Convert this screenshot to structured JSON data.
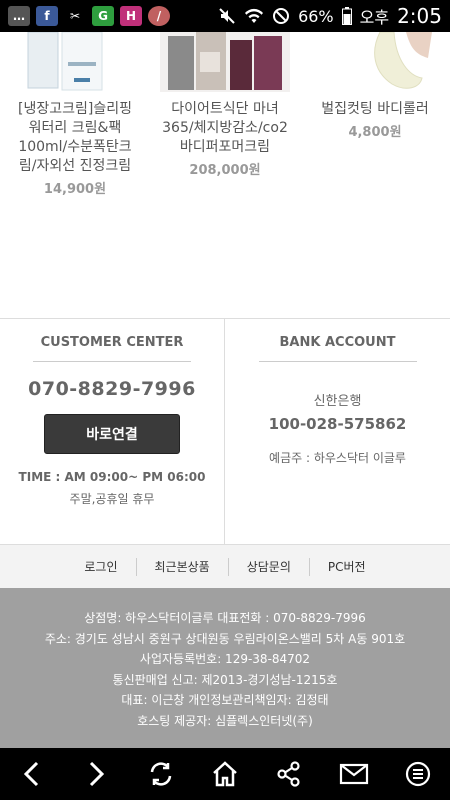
{
  "status_bar": {
    "battery": "66%",
    "ampm": "오후",
    "time": "2:05",
    "app_icons": [
      {
        "name": "message-icon",
        "label": "…",
        "color": "#555555"
      },
      {
        "name": "facebook-icon",
        "label": "f",
        "color": "#3b5998"
      },
      {
        "name": "scissors-icon",
        "label": "✂",
        "color": "#000000"
      },
      {
        "name": "g-app-icon",
        "label": "G",
        "color": "#2e9e3e"
      },
      {
        "name": "h-app-icon",
        "label": "H",
        "color": "#c0307a"
      },
      {
        "name": "circle-app-icon",
        "label": "/",
        "color": "#c06060"
      }
    ]
  },
  "products": [
    {
      "name": "[냉장고크림]슬리핑 워터리 크림&팩 100ml/수분폭탄크림/자외선 진정크림",
      "price": "14,900원"
    },
    {
      "name": "다이어트식단 마녀365/체지방감소/co2바디퍼포머크림",
      "price": "208,000원"
    },
    {
      "name": "벌집컷팅 바디롤러",
      "price": "4,800원"
    }
  ],
  "customer_center": {
    "heading": "CUSTOMER CENTER",
    "phone": "070-8829-7996",
    "call_label": "바로연결",
    "time": "TIME : AM 09:00~ PM 06:00",
    "holiday": "주말,공휴일 휴무"
  },
  "bank_account": {
    "heading": "BANK ACCOUNT",
    "bank": "신한은행",
    "account": "100-028-575862",
    "holder": "예금주 : 하우스닥터 이글루"
  },
  "footer_nav": [
    "로그인",
    "최근본상품",
    "상담문의",
    "PC버전"
  ],
  "company_info": [
    "상점명: 하우스닥터이글루 대표전화 : 070-8829-7996",
    "주소: 경기도 성남시 중원구 상대원동 우림라이온스밸리 5차 A동 901호",
    "사업자등록번호: 129-38-84702",
    "통신판매업 신고: 제2013-경기성남-1215호",
    "대표: 이근창 개인정보관리책임자: 김정태",
    "호스팅 제공자: 심플렉스인터넷(주)"
  ],
  "bottom_bar_icons": [
    "back-icon",
    "forward-icon",
    "refresh-icon",
    "home-icon",
    "share-icon",
    "mail-icon",
    "menu-icon"
  ]
}
